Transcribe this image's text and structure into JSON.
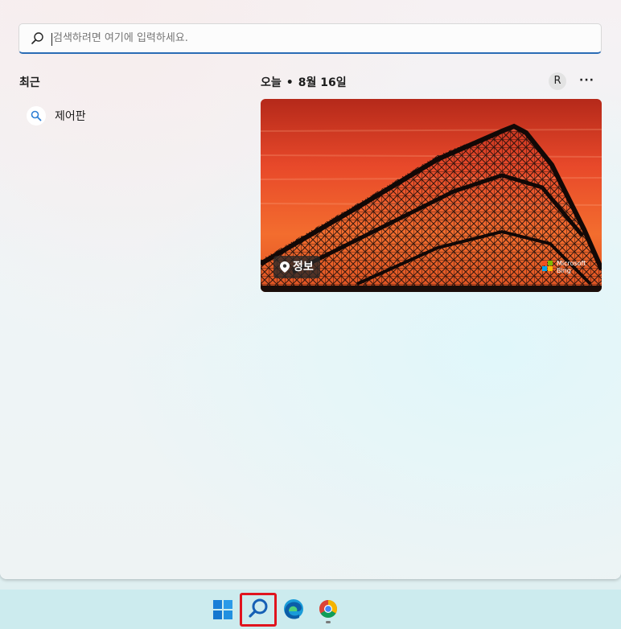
{
  "search": {
    "placeholder": "검색하려면 여기에 입력하세요."
  },
  "recent": {
    "title": "최근",
    "items": [
      {
        "label": "제어판",
        "icon": "search-icon"
      }
    ]
  },
  "today": {
    "label": "오늘",
    "date": "8월 16일",
    "avatar_initial": "R",
    "more_label": "···"
  },
  "card": {
    "info_label": "정보",
    "brand_line1": "Microsoft",
    "brand_line2": "Bing"
  },
  "taskbar": {
    "apps": [
      "windows-start",
      "search",
      "edge",
      "chrome"
    ],
    "highlight_color": "#e0141e"
  },
  "colors": {
    "accent": "#2a6cb5",
    "sky_top": "#c4311a",
    "sky_bottom": "#f06a2c"
  }
}
